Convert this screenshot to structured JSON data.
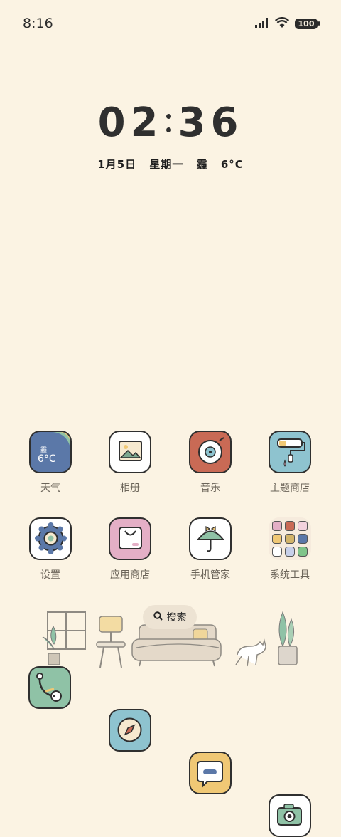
{
  "status_bar": {
    "time": "8:16",
    "battery": "100"
  },
  "lockclock": {
    "hours": "02",
    "minutes": "36",
    "date": "1月5日",
    "weekday": "星期一",
    "weather": "霾",
    "temp": "6°C"
  },
  "apps": [
    {
      "label": "天气",
      "icon_text": "霾",
      "icon_temp": "6°C",
      "color": "#5B78A8"
    },
    {
      "label": "相册",
      "color": "#FFFFFF"
    },
    {
      "label": "音乐",
      "color": "#C96A55"
    },
    {
      "label": "主题商店",
      "color": "#8EC3CF"
    },
    {
      "label": "设置",
      "color": "#FFFFFF"
    },
    {
      "label": "应用商店",
      "color": "#E4AFC6"
    },
    {
      "label": "手机管家",
      "color": "#FFFFFF"
    },
    {
      "label": "系统工具"
    }
  ],
  "search": {
    "label": "搜索"
  },
  "dock": [
    {
      "name": "phone",
      "color": "#8FC2A6"
    },
    {
      "name": "browser",
      "color": "#8EC3CF"
    },
    {
      "name": "messages",
      "color": "#F0C875"
    },
    {
      "name": "camera",
      "color": "#FFFFFF"
    }
  ]
}
